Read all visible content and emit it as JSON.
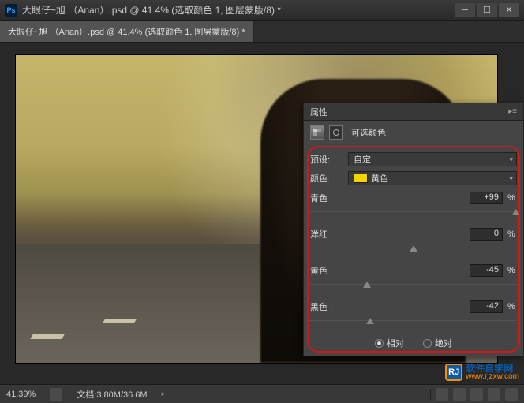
{
  "titlebar": {
    "ps": "Ps",
    "title": "大眼仔~旭 （Anan）.psd @ 41.4% (选取颜色 1, 图层蒙版/8) *"
  },
  "doc_tab": "大眼仔~旭 （Anan）.psd @ 41.4% (选取颜色 1, 图层蒙版/8) *",
  "panel": {
    "tab": "属性",
    "title": "可选颜色",
    "preset_label": "预设:",
    "preset_value": "自定",
    "color_label": "颜色:",
    "color_value": "黄色",
    "swatch": "#f5d400",
    "sliders": [
      {
        "name": "青色 :",
        "value": "+99",
        "pos": 99.5
      },
      {
        "name": "洋红 :",
        "value": "0",
        "pos": 50
      },
      {
        "name": "黄色 :",
        "value": "-45",
        "pos": 27.5
      },
      {
        "name": "黑色 :",
        "value": "-42",
        "pos": 29
      }
    ],
    "pct": "%",
    "method": {
      "relative": "相对",
      "absolute": "绝对",
      "selected": "relative"
    }
  },
  "statusbar": {
    "zoom": "41.39%",
    "doc": "文档:3.80M/36.6M"
  },
  "watermark": {
    "logo": "RJ",
    "cn": "软件自学网",
    "url": "www.rjzxw.com"
  }
}
